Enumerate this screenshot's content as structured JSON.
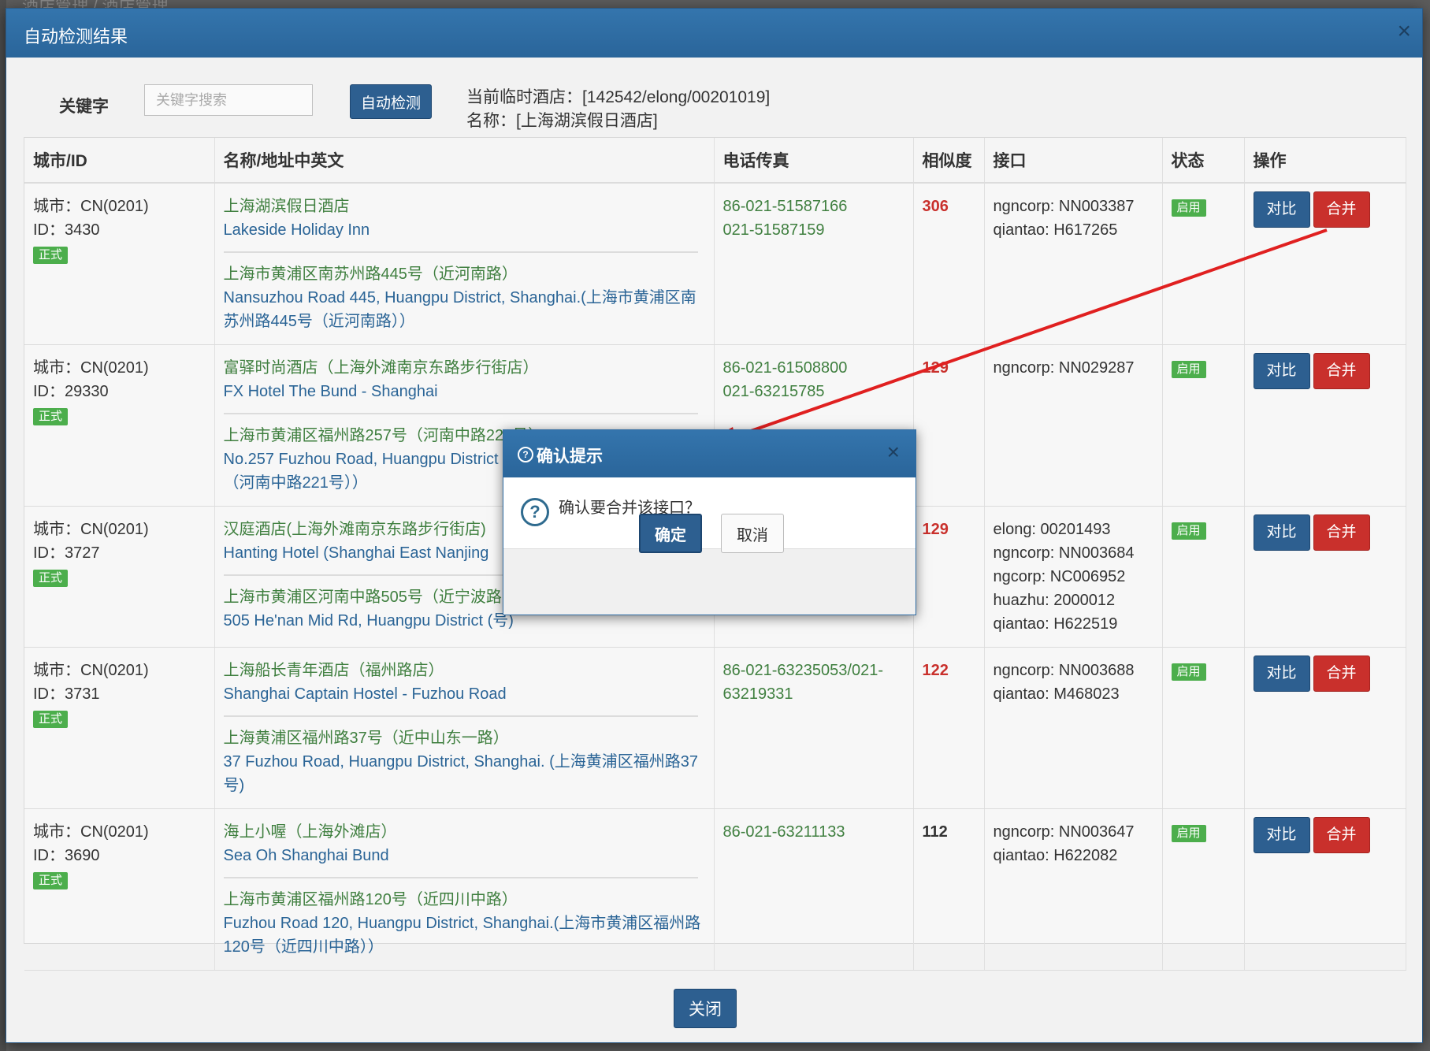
{
  "background": {
    "breadcrumb": "酒店管理 / 酒店管理"
  },
  "modal": {
    "title": "自动检测结果",
    "close": "×"
  },
  "toolbar": {
    "keyword_label": "关键字",
    "keyword_placeholder": "关键字搜索",
    "auto_detect": "自动检测",
    "current_hotel": "当前临时酒店：[142542/elong/00201019]",
    "current_name": "名称：[上海湖滨假日酒店]"
  },
  "table": {
    "headers": [
      "城市/ID",
      "名称/地址中英文",
      "电话传真",
      "相似度",
      "接口",
      "状态",
      "操作"
    ],
    "rows": [
      {
        "city": "城市：CN(0201)",
        "id": "ID：3430",
        "tag": "正式",
        "name_cn": "上海湖滨假日酒店",
        "name_en": "Lakeside Holiday Inn",
        "addr_cn": "上海市黄浦区南苏州路445号（近河南路）",
        "addr_en": "Nansuzhou Road 445, Huangpu District, Shanghai.(上海市黄浦区南苏州路445号（近河南路））",
        "phone1": "86-021-51587166",
        "phone2": "021-51587159",
        "similarity": "306",
        "sim_red": true,
        "interfaces": [
          "ngncorp: NN003387",
          "qiantao: H617265"
        ],
        "status": "启用",
        "compare": "对比",
        "merge": "合并"
      },
      {
        "city": "城市：CN(0201)",
        "id": "ID：29330",
        "tag": "正式",
        "name_cn": "富驿时尚酒店（上海外滩南京东路步行街店）",
        "name_en": "FX Hotel The Bund - Shanghai",
        "addr_cn": "上海市黄浦区福州路257号（河南中路221号）",
        "addr_en": "No.257 Fuzhou Road, Huangpu District (上海市黄浦区福州路257号（河南中路221号））",
        "phone1": "86-021-61508800",
        "phone2": "021-63215785",
        "similarity": "129",
        "sim_red": true,
        "interfaces": [
          "ngncorp: NN029287"
        ],
        "status": "启用",
        "compare": "对比",
        "merge": "合并"
      },
      {
        "city": "城市：CN(0201)",
        "id": "ID：3727",
        "tag": "正式",
        "name_cn": "汉庭酒店(上海外滩南京东路步行街店)",
        "name_en": "Hanting Hotel (Shanghai East Nanjing",
        "addr_cn": "上海市黄浦区河南中路505号（近宁波路）",
        "addr_en": "505 He'nan Mid Rd, Huangpu District (号)",
        "phone1": "",
        "phone2": "",
        "similarity": "129",
        "sim_red": true,
        "interfaces": [
          "elong: 00201493",
          "ngncorp: NN003684",
          "ngcorp: NC006952",
          "huazhu: 2000012",
          "qiantao: H622519"
        ],
        "status": "启用",
        "compare": "对比",
        "merge": "合并"
      },
      {
        "city": "城市：CN(0201)",
        "id": "ID：3731",
        "tag": "正式",
        "name_cn": "上海船长青年酒店（福州路店）",
        "name_en": "Shanghai Captain Hostel - Fuzhou Road",
        "addr_cn": "上海黄浦区福州路37号（近中山东一路）",
        "addr_en": "37 Fuzhou Road, Huangpu District, Shanghai. (上海黄浦区福州路37号)",
        "phone1": "86-021-63235053/021-63219331",
        "phone2": "",
        "similarity": "122",
        "sim_red": true,
        "interfaces": [
          "ngncorp: NN003688",
          "qiantao: M468023"
        ],
        "status": "启用",
        "compare": "对比",
        "merge": "合并"
      },
      {
        "city": "城市：CN(0201)",
        "id": "ID：3690",
        "tag": "正式",
        "name_cn": "海上小喔（上海外滩店）",
        "name_en": "Sea Oh Shanghai Bund",
        "addr_cn": "上海市黄浦区福州路120号（近四川中路）",
        "addr_en": "Fuzhou Road 120, Huangpu District, Shanghai.(上海市黄浦区福州路120号（近四川中路））",
        "phone1": "86-021-63211133",
        "phone2": "",
        "similarity": "112",
        "sim_red": false,
        "interfaces": [
          "ngncorp: NN003647",
          "qiantao: H622082"
        ],
        "status": "启用",
        "compare": "对比",
        "merge": "合并"
      }
    ]
  },
  "footer": {
    "close": "关闭"
  },
  "confirm": {
    "title": "确认提示",
    "message": "确认要合并该接口？",
    "ok": "确定",
    "cancel": "取消",
    "close": "×"
  },
  "colors": {
    "header_blue": "#2f6ba2",
    "merge_red": "#c9302c",
    "status_green": "#4cae4c",
    "arrow_red": "#e02020"
  }
}
